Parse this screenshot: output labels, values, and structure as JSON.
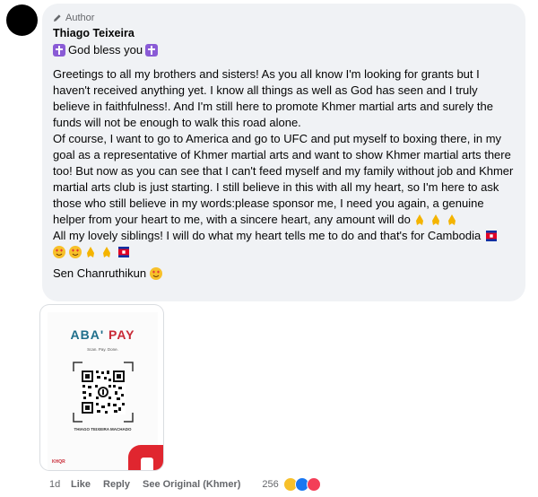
{
  "comment": {
    "author_badge": "Author",
    "author_name": "Thiago Teixeira",
    "first_line": "God bless you",
    "paragraph1": "Greetings to all my brothers and sisters! As you all know I'm looking for grants but I haven't received anything yet. I know all things as well as God has seen and I truly believe in faithfulness!. And I'm still here to promote Khmer martial arts and surely the funds will not be enough to walk this road alone.",
    "paragraph2": "Of course, I want to go to America and go to UFC and put myself to boxing there, in my goal as a representative of Khmer martial arts and want to show Khmer martial arts there too! But now as you can see that I can't feed myself and my family without job and Khmer martial arts club is just starting. I still believe in this with all my heart, so I'm here to ask those who still believe in my words:please sponsor me, I need you again, a genuine helper from your heart to me, with a sincere heart, any amount will do",
    "paragraph3": "All my lovely siblings! I will do what my heart tells me to do and that's for Cambodia",
    "signature": "Sen Chanruthikun"
  },
  "attachment": {
    "logo_main": "ABA'",
    "logo_pay": "PAY",
    "tagline": "Scan. Pay. Done.",
    "account_name": "THIAGO TEIXEIRA MACHADO",
    "network": "KHQR"
  },
  "actions": {
    "time": "1d",
    "like": "Like",
    "reply": "Reply",
    "see_original": "See Original (Khmer)",
    "reaction_count": "256"
  },
  "colors": {
    "bubble": "#f0f2f5",
    "muted": "#65676b",
    "aba_blue": "#1f6f8b",
    "aba_red": "#c92a37"
  }
}
